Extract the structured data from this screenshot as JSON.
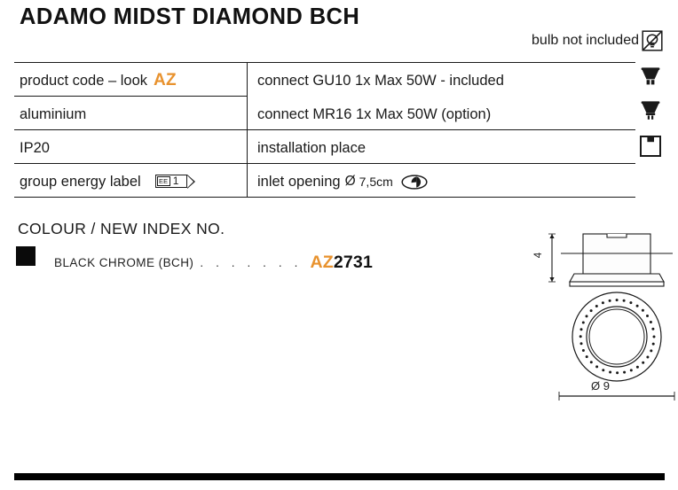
{
  "header": {
    "title": "ADAMO MIDST DIAMOND BCH",
    "bulb_note": "bulb not included",
    "bulb_note_icon": "bulb-crossed-out-icon"
  },
  "spec_table": {
    "left_column": [
      {
        "label": "product code – look",
        "accent": "AZ",
        "icon": null
      },
      {
        "label": "aluminium",
        "accent": null,
        "icon": null
      },
      {
        "label": "IP20",
        "accent": null,
        "icon": null
      },
      {
        "label": "group energy label",
        "accent": null,
        "icon": "energy-label-badge",
        "badge": {
          "class_text": "EE",
          "value": "1"
        }
      }
    ],
    "right_column": [
      {
        "label": "connect GU10 1x Max 50W - included",
        "icon": "gu10-lamp-icon"
      },
      {
        "label": "connect MR16 1x Max 50W (option)",
        "icon": "mr16-lamp-icon"
      },
      {
        "label": "installation place",
        "icon": "ceiling-mount-icon"
      },
      {
        "label": "inlet opening",
        "diameter_symbol": "Ø",
        "value": "7,5cm",
        "icon": "inlet-opening-icon"
      }
    ]
  },
  "colour_section": {
    "heading": "COLOUR / NEW INDEX NO.",
    "swatch_color": "#0a0a0a",
    "name": "BLACK CHROME (BCH)",
    "leader": ". . . . . . .",
    "code_prefix": "AZ",
    "code_number": "2731"
  },
  "technical_drawings": {
    "side_view": {
      "name": "side-section-view",
      "height_dimension": "4"
    },
    "top_view": {
      "name": "top-plan-view",
      "diameter_dimension": "Ø 9"
    }
  },
  "colors": {
    "accent_orange": "#e8922e",
    "ink": "#1a1a1a",
    "bar": "#000000"
  }
}
